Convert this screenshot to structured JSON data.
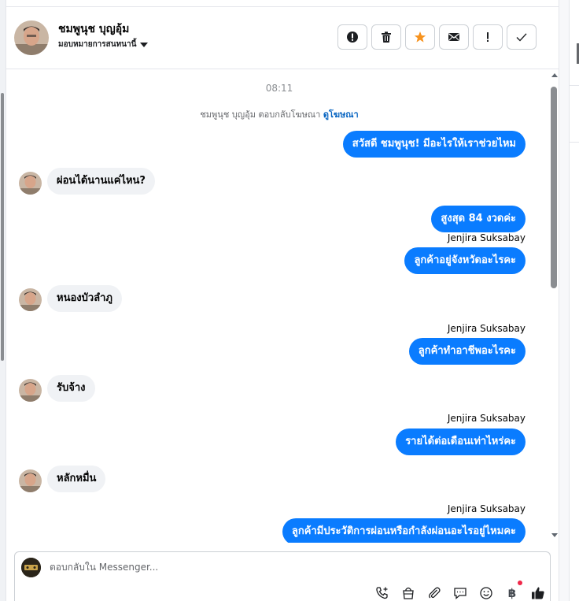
{
  "header": {
    "contact_name": "ชมพูนุช บุญอุ้ม",
    "assign_label": "มอบหมายการสนทนานี้",
    "actions": [
      {
        "icon": "alert-circle-icon",
        "name": "mark-spam-button"
      },
      {
        "icon": "trash-icon",
        "name": "delete-button"
      },
      {
        "icon": "star-icon",
        "name": "star-button"
      },
      {
        "icon": "envelope-icon",
        "name": "mark-unread-button"
      },
      {
        "icon": "exclamation-icon",
        "name": "follow-up-button"
      },
      {
        "icon": "check-icon",
        "name": "mark-done-button"
      }
    ],
    "star_color": "#f7931e"
  },
  "thread": {
    "time": "08:11",
    "notice_text": "ชมพูนุช บุญอุ้ม ตอบกลับโฆษณา",
    "notice_link": "ดูโฆษณา",
    "messages": [
      {
        "dir": "out",
        "text": "สวัสดี ชมพูนุช! มีอะไรให้เราช่วยไหม"
      },
      {
        "dir": "in",
        "text": "ผ่อนได้นานแค่ไหน?"
      },
      {
        "dir": "out",
        "text": "สูงสุด 84 งวดค่ะ"
      },
      {
        "dir": "sender",
        "text": "Jenjira Suksabay"
      },
      {
        "dir": "out",
        "text": "ลูกค้าอยู่จังหวัดอะไรคะ"
      },
      {
        "dir": "in",
        "text": "หนองบัวลำภู"
      },
      {
        "dir": "sender",
        "text": "Jenjira Suksabay"
      },
      {
        "dir": "out",
        "text": "ลูกค้าทำอาชีพอะไรคะ"
      },
      {
        "dir": "in",
        "text": "รับจ้าง"
      },
      {
        "dir": "sender",
        "text": "Jenjira Suksabay"
      },
      {
        "dir": "out",
        "text": "รายได้ต่อเดือนเท่าไหร่คะ"
      },
      {
        "dir": "in",
        "text": "หลักหมื่น"
      },
      {
        "dir": "sender",
        "text": "Jenjira Suksabay"
      },
      {
        "dir": "out",
        "text": "ลูกค้ามีประวัติการผ่อนหรือกำลังผ่อนอะไรอยู่ไหมคะ"
      }
    ],
    "outgoing_color": "#0a7cff",
    "incoming_color": "#f0f2f5"
  },
  "composer": {
    "placeholder": "ตอบกลับใน Messenger...",
    "tools": [
      "phone-plus-icon",
      "shopping-bag-icon",
      "paperclip-icon",
      "chat-bubble-icon",
      "smiley-icon",
      "baht-icon",
      "thumbs-up-icon"
    ],
    "baht_symbol": "฿"
  }
}
